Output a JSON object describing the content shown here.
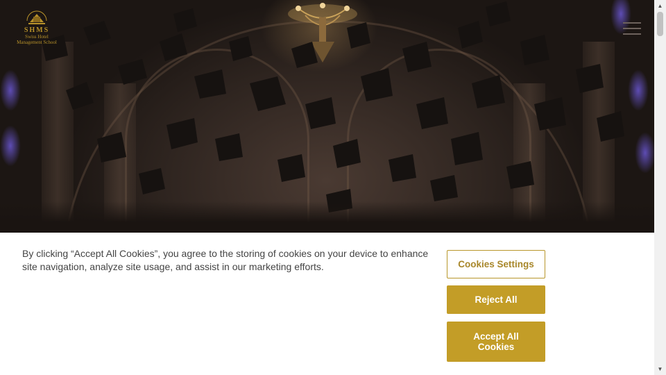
{
  "header": {
    "logo": {
      "brand": "SHMS",
      "subtitle_line1": "Swiss Hotel",
      "subtitle_line2": "Management School",
      "ring_text": "CENTRE OF EXCELLENCE",
      "color": "#b8922a"
    },
    "menu_icon": "hamburger-menu-icon"
  },
  "hero": {
    "description_icon": "graduation-caps-image"
  },
  "cookie_banner": {
    "message": "By clicking “Accept All Cookies”, you agree to the storing of cookies on your device to enhance site navigation, analyze site usage, and assist in our marketing efforts.",
    "settings_label": "Cookies Settings",
    "reject_label": "Reject All",
    "accept_label": "Accept All Cookies",
    "accent_color": "#c39d27"
  },
  "scrollbar": {
    "up_icon": "scroll-up-arrow-icon",
    "down_icon": "scroll-down-arrow-icon"
  }
}
